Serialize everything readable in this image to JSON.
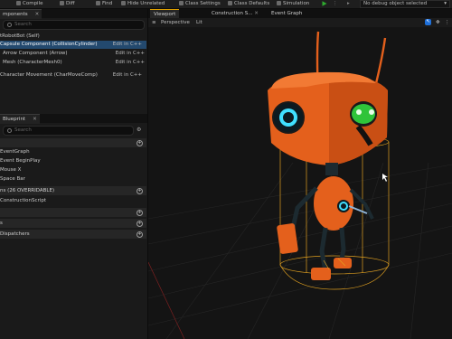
{
  "toolbar": {
    "compile_label": "Compile",
    "diff_label": "Diff",
    "find_label": "Find",
    "hide_unrelated_label": "Hide Unrelated",
    "class_settings_label": "Class Settings",
    "class_defaults_label": "Class Defaults",
    "simulation_label": "Simulation",
    "debug_filter_label": "No debug object selected"
  },
  "components_panel": {
    "tab_label": "mponents",
    "search_placeholder": "Search",
    "root_label": "tRobotBot (Self)",
    "items": [
      {
        "label": "Capsule Component (CollisionCylinder)",
        "link": "Edit in C++",
        "selected": true
      },
      {
        "label": "Arrow Component (Arrow)",
        "link": "Edit in C++",
        "selected": false
      },
      {
        "label": "Mesh (CharacterMesh0)",
        "link": "Edit in C++",
        "selected": false
      },
      {
        "label": "Character Movement (CharMoveComp)",
        "link": "Edit in C++",
        "selected": false
      }
    ]
  },
  "myblueprint_panel": {
    "tab_label": "Blueprint",
    "search_placeholder": "Search",
    "graphs_items": [
      "EventGraph",
      "Event BeginPlay",
      "Mouse X",
      "Space Bar"
    ],
    "functions_header": "ns (26 OVERRIDABLE)",
    "functions_items": [
      "ConstructionScript"
    ],
    "sections": [
      "s",
      "Dispatchers"
    ]
  },
  "viewport": {
    "tabs": [
      "Viewport",
      "Construction S...",
      "Event Graph"
    ],
    "perspective_label": "Perspective",
    "lit_label": "Lit"
  },
  "colors": {
    "robot_orange": "#e4601c",
    "eye_cyan": "#40e0ff",
    "eye_green": "#2fc43a",
    "selection_yellow": "#e0a020",
    "selection_blue": "#23496e"
  }
}
